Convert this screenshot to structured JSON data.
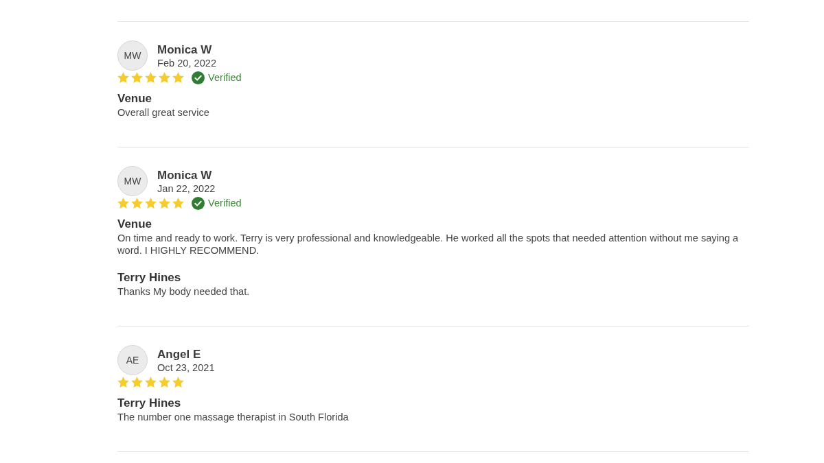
{
  "reviews": [
    {
      "initials": "MW",
      "name": "Monica W",
      "date": "Feb 20, 2022",
      "stars": 5,
      "verified": true,
      "verified_label": "Verified",
      "blocks": [
        {
          "heading": "Venue",
          "text": "Overall great service"
        }
      ]
    },
    {
      "initials": "MW",
      "name": "Monica W",
      "date": "Jan 22, 2022",
      "stars": 5,
      "verified": true,
      "verified_label": "Verified",
      "blocks": [
        {
          "heading": "Venue",
          "text": "On time and ready to work. Terry is very professional and knowledgeable. He worked all the spots that needed attention without me saying a word. I HIGHLY RECOMMEND."
        },
        {
          "heading": "Terry Hines",
          "text": "Thanks My body needed that."
        }
      ]
    },
    {
      "initials": "AE",
      "name": "Angel E",
      "date": "Oct 23, 2021",
      "stars": 5,
      "verified": false,
      "blocks": [
        {
          "heading": "Terry Hines",
          "text": "The number one massage therapist in South Florida"
        }
      ]
    }
  ]
}
